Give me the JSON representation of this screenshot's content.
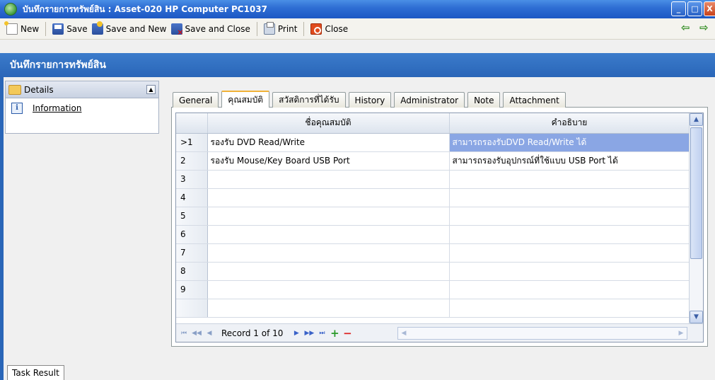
{
  "window": {
    "title": "บันทึกรายการทรัพย์สิน : Asset-020 HP Computer PC1037",
    "buttons": [
      "_",
      "□",
      "X"
    ]
  },
  "toolbar": {
    "new_label": "New",
    "save_label": "Save",
    "save_and_new_label": "Save and New",
    "save_and_close_label": "Save and Close",
    "print_label": "Print",
    "close_label": "Close"
  },
  "section": {
    "title": "บันทึกรายการทรัพย์สิน"
  },
  "left_panel": {
    "header": "Details",
    "items": [
      {
        "label": "Information",
        "icon": "info-icon"
      }
    ]
  },
  "tabs": [
    {
      "label": "General"
    },
    {
      "label": "คุณสมบัติ",
      "active": true
    },
    {
      "label": "สวัสดิการที่ได้รับ"
    },
    {
      "label": "History"
    },
    {
      "label": "Administrator"
    },
    {
      "label": "Note"
    },
    {
      "label": "Attachment"
    }
  ],
  "grid": {
    "columns": [
      "ชื่อคุณสมบัติ",
      "คำอธิบาย"
    ],
    "rows": [
      {
        "num": ">1",
        "name": "รองรับ DVD Read/Write",
        "desc": "สามารถรองรับDVD Read/Write ได้",
        "selected": true
      },
      {
        "num": "2",
        "name": "รองรับ Mouse/Key Board USB Port",
        "desc": "สามารถรองรับอุปกรณ์ที่ใช้แบบ USB Port ได้"
      },
      {
        "num": "3",
        "name": "",
        "desc": ""
      },
      {
        "num": "4",
        "name": "",
        "desc": ""
      },
      {
        "num": "5",
        "name": "",
        "desc": ""
      },
      {
        "num": "6",
        "name": "",
        "desc": ""
      },
      {
        "num": "7",
        "name": "",
        "desc": ""
      },
      {
        "num": "8",
        "name": "",
        "desc": ""
      },
      {
        "num": "9",
        "name": "",
        "desc": ""
      },
      {
        "num": "",
        "name": "",
        "desc": ""
      }
    ],
    "record_text": "Record 1 of 10"
  },
  "bottom": {
    "task_result_label": "Task Result"
  },
  "colors": {
    "header_blue": "#2a66b8",
    "selection": "#8aa6e4",
    "active_tab_accent": "#f0b238"
  }
}
